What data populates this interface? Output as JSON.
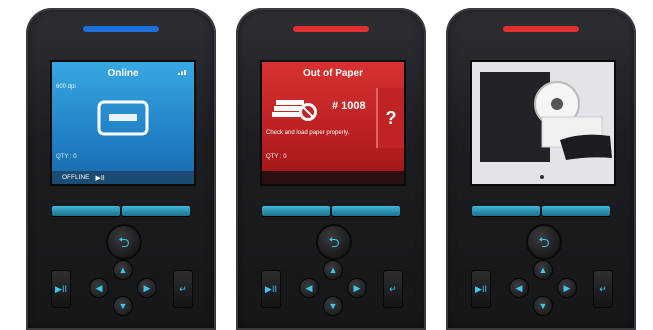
{
  "devices": [
    {
      "led_color": "#1e6fd9",
      "screen": {
        "title": "Online",
        "dpi": "600 dpi",
        "qty": "QTY : 0",
        "footer": "OFFLINE",
        "signal_icon": "wifi-icon"
      }
    },
    {
      "led_color": "#e03030",
      "screen": {
        "title": "Out of Paper",
        "job": "# 1008",
        "message": "Check and load paper properly.",
        "qty": "QTY : 0",
        "help": "?"
      }
    },
    {
      "led_color": "#e03030",
      "screen": {
        "content": "printer-video-icon"
      }
    }
  ],
  "keypad": {
    "ok_icon": "return-icon",
    "up": "▲",
    "down": "▼",
    "left": "◀",
    "right": "▶",
    "play_pause": "▶II",
    "enter": "↵"
  }
}
